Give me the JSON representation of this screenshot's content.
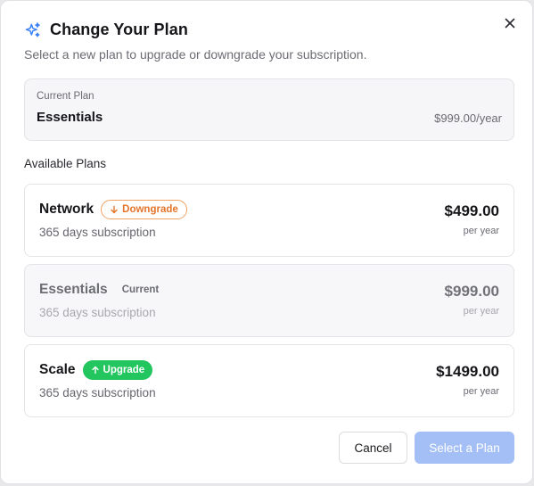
{
  "modal": {
    "title": "Change Your Plan",
    "subtitle": "Select a new plan to upgrade or downgrade your subscription.",
    "title_icon": "sparkles-icon",
    "close_icon": "close-icon"
  },
  "current_plan": {
    "label": "Current Plan",
    "name": "Essentials",
    "price": "$999.00/year"
  },
  "available": {
    "label": "Available Plans",
    "plans": [
      {
        "name": "Network",
        "badge": "Downgrade",
        "badge_icon": "arrow-down-icon",
        "description": "365 days subscription",
        "price": "$499.00",
        "period": "per year"
      },
      {
        "name": "Essentials",
        "badge": "Current",
        "description": "365 days subscription",
        "price": "$999.00",
        "period": "per year"
      },
      {
        "name": "Scale",
        "badge": "Upgrade",
        "badge_icon": "arrow-up-icon",
        "description": "365 days subscription",
        "price": "$1499.00",
        "period": "per year"
      }
    ]
  },
  "actions": {
    "cancel_label": "Cancel",
    "select_label": "Select a Plan"
  },
  "colors": {
    "accent_icon": "#3b82f6",
    "downgrade": "#e3742a",
    "upgrade": "#22c55e",
    "primary_disabled": "#a4bff5"
  }
}
